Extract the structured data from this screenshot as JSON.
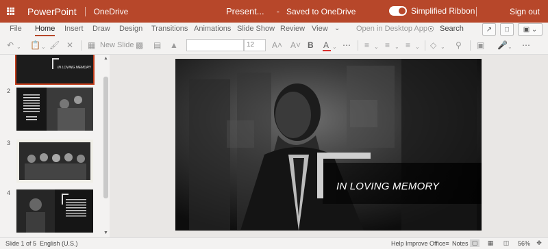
{
  "titlebar": {
    "app_name": "PowerPoint",
    "location": "OneDrive",
    "doc_title": "Present...",
    "dash": "-",
    "save_status": "Saved to OneDrive",
    "ribbon_toggle_label": "Simplified Ribbon",
    "sign_out": "Sign out",
    "accent": "#b7472a"
  },
  "tabs": [
    {
      "label": "File"
    },
    {
      "label": "Home"
    },
    {
      "label": "Insert"
    },
    {
      "label": "Draw"
    },
    {
      "label": "Design"
    },
    {
      "label": "Transitions"
    },
    {
      "label": "Animations"
    },
    {
      "label": "Slide Show"
    },
    {
      "label": "Review"
    },
    {
      "label": "View"
    }
  ],
  "active_tab": "Home",
  "open_desktop": "Open in Desktop App",
  "search_label": "Search",
  "ribbon": {
    "new_slide": "New Slide",
    "font_size": "12"
  },
  "thumbnails": [
    {
      "number": "",
      "text": "IN LOVING MEMORY"
    },
    {
      "number": "2",
      "text": ""
    },
    {
      "number": "3",
      "text": ""
    },
    {
      "number": "4",
      "text": ""
    }
  ],
  "slide": {
    "title": "IN LOVING MEMORY"
  },
  "status": {
    "slide_info": "Slide 1 of 5",
    "language": "English (U.S.)",
    "help": "Help Improve Office",
    "notes": "Notes",
    "zoom": "56%"
  }
}
